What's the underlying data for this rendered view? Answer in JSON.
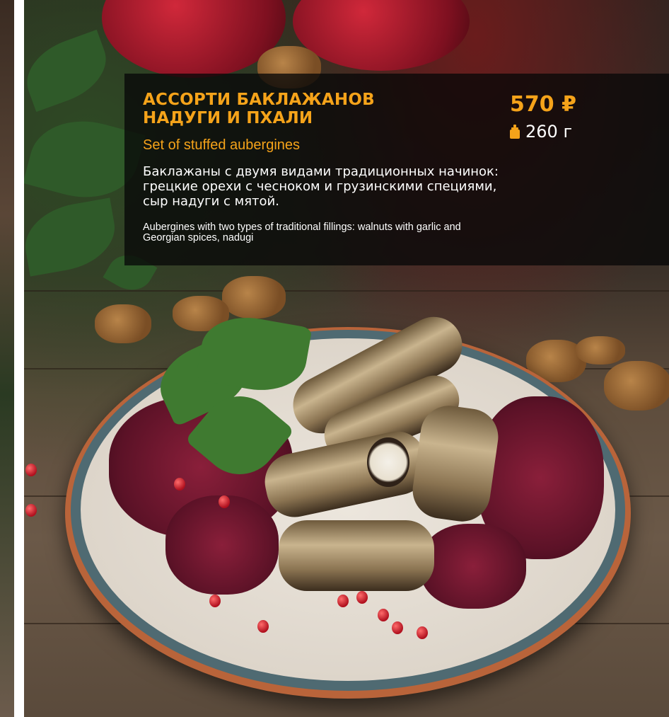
{
  "dish": {
    "title_ru": "АССОРТИ БАКЛАЖАНОВ НАДУГИ И ПХАЛИ",
    "title_en": "Set of stuffed aubergines",
    "description_ru": "Баклажаны с двумя видами традиционных начинок: грецкие орехи с чесноком и грузинскими специями, сыр надуги с мятой.",
    "description_en": "Aubergines with two types of traditional fillings: walnuts with garlic and Georgian spices, nadugi",
    "price": "570 ₽",
    "weight": "260 г",
    "weight_icon": "weight-icon"
  },
  "colors": {
    "accent": "#f5a31a",
    "panel_bg": "rgba(8,8,8,0.78)",
    "text": "#ffffff"
  }
}
